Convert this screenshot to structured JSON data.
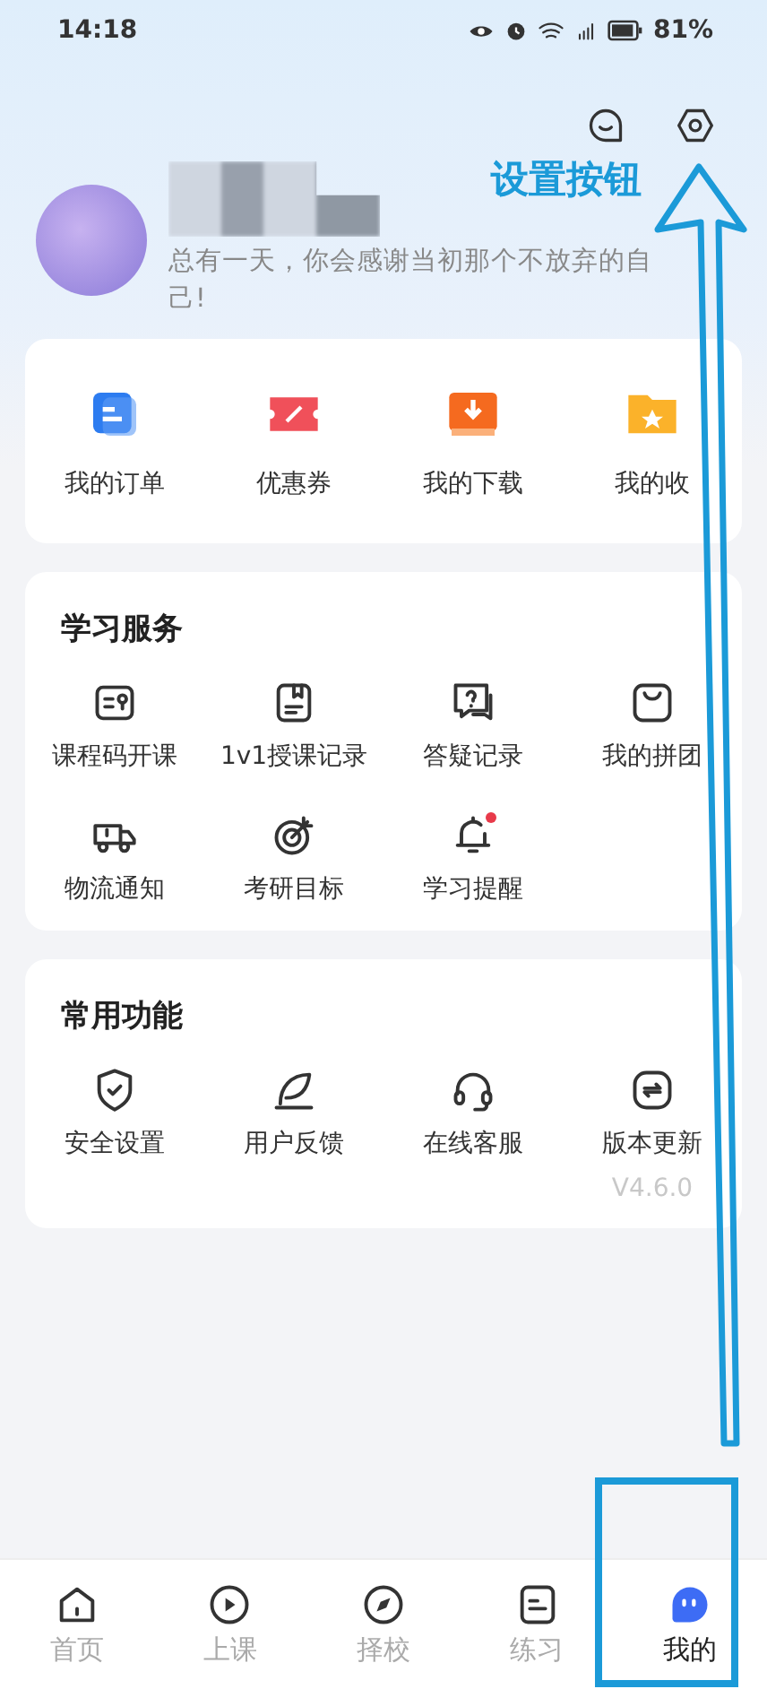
{
  "status_bar": {
    "time": "14:18",
    "battery": "81%"
  },
  "profile": {
    "motto": "总有一天，你会感谢当初那个不放弃的自己!"
  },
  "shortcuts": [
    {
      "label": "我的订单"
    },
    {
      "label": "优惠券"
    },
    {
      "label": "我的下载"
    },
    {
      "label": "我的收"
    }
  ],
  "study_services": {
    "title": "学习服务",
    "items": [
      {
        "label": "课程码开课",
        "dot": false
      },
      {
        "label": "1v1授课记录",
        "dot": false
      },
      {
        "label": "答疑记录",
        "dot": false
      },
      {
        "label": "我的拼团",
        "dot": false
      },
      {
        "label": "物流通知",
        "dot": false
      },
      {
        "label": "考研目标",
        "dot": false
      },
      {
        "label": "学习提醒",
        "dot": true
      }
    ]
  },
  "common_functions": {
    "title": "常用功能",
    "items": [
      {
        "label": "安全设置"
      },
      {
        "label": "用户反馈"
      },
      {
        "label": "在线客服"
      },
      {
        "label": "版本更新",
        "note": "V4.6.0"
      }
    ]
  },
  "tab_bar": [
    {
      "label": "首页",
      "selected": false
    },
    {
      "label": "上课",
      "selected": false
    },
    {
      "label": "择校",
      "selected": false
    },
    {
      "label": "练习",
      "selected": false
    },
    {
      "label": "我的",
      "selected": true
    }
  ],
  "annotation": {
    "label": "设置按钮"
  }
}
